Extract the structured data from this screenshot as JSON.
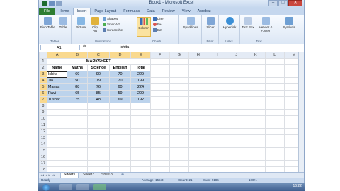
{
  "window": {
    "title": "Book1 - Microsoft Excel",
    "buttons": {
      "min": "–",
      "max": "□",
      "close": "✕"
    }
  },
  "tabs": [
    "File",
    "Home",
    "Insert",
    "Page Layout",
    "Formulas",
    "Data",
    "Review",
    "View",
    "Acrobat"
  ],
  "active_tab": "Insert",
  "ribbon": {
    "pivot_table": "PivotTable",
    "table": "Table",
    "picture": "Picture",
    "clip_art": "Clip Art",
    "shapes": "Shapes",
    "smartart": "SmartArt",
    "screenshot": "Screenshot",
    "column": "Column",
    "line": "Line",
    "pie": "Pie",
    "bar": "Bar",
    "sparklines": "Sparklines",
    "slicer": "Slicer",
    "hyperlink": "Hyperlink",
    "text_box": "Text Box",
    "header_footer": "Header & Footer",
    "symbols": "Symbols",
    "group_tables": "Tables",
    "group_illustrations": "Illustrations",
    "group_charts": "Charts",
    "group_filter": "Filter",
    "group_links": "Links",
    "group_text": "Text"
  },
  "formula_bar": {
    "name_box": "A1",
    "fx": "fx",
    "value": "Ishita"
  },
  "columns": [
    "A",
    "B",
    "C",
    "D",
    "E",
    "F",
    "G",
    "H",
    "I",
    "J",
    "K",
    "L",
    "M"
  ],
  "rows": [
    "1",
    "2",
    "3",
    "4",
    "5",
    "6",
    "7",
    "8",
    "9",
    "10",
    "11",
    "12",
    "13",
    "14",
    "15",
    "16",
    "17",
    "18"
  ],
  "sheet": {
    "title": "MARKSHEET",
    "headers": [
      "Name",
      "Maths",
      "Science",
      "English",
      "Total"
    ],
    "records": [
      [
        "Ishita",
        "69",
        "90",
        "70",
        "229"
      ],
      [
        "Jia",
        "50",
        "79",
        "70",
        "199"
      ],
      [
        "Manas",
        "88",
        "76",
        "60",
        "224"
      ],
      [
        "Ravi",
        "65",
        "85",
        "59",
        "209"
      ],
      [
        "Tushar",
        "75",
        "48",
        "69",
        "192"
      ]
    ]
  },
  "sheet_tabs": [
    "Sheet1",
    "Sheet2",
    "Sheet3"
  ],
  "status": {
    "ready": "Ready",
    "average": "Average: 155.3",
    "count": "Count: 21",
    "sum": "Sum: 2186",
    "zoom": "100%"
  },
  "taskbar": {
    "clock": "16:22"
  },
  "colors": {
    "selection": "#bcd3ec",
    "header_selected": "#f9d98f",
    "file_tab": "#2e7d32"
  }
}
